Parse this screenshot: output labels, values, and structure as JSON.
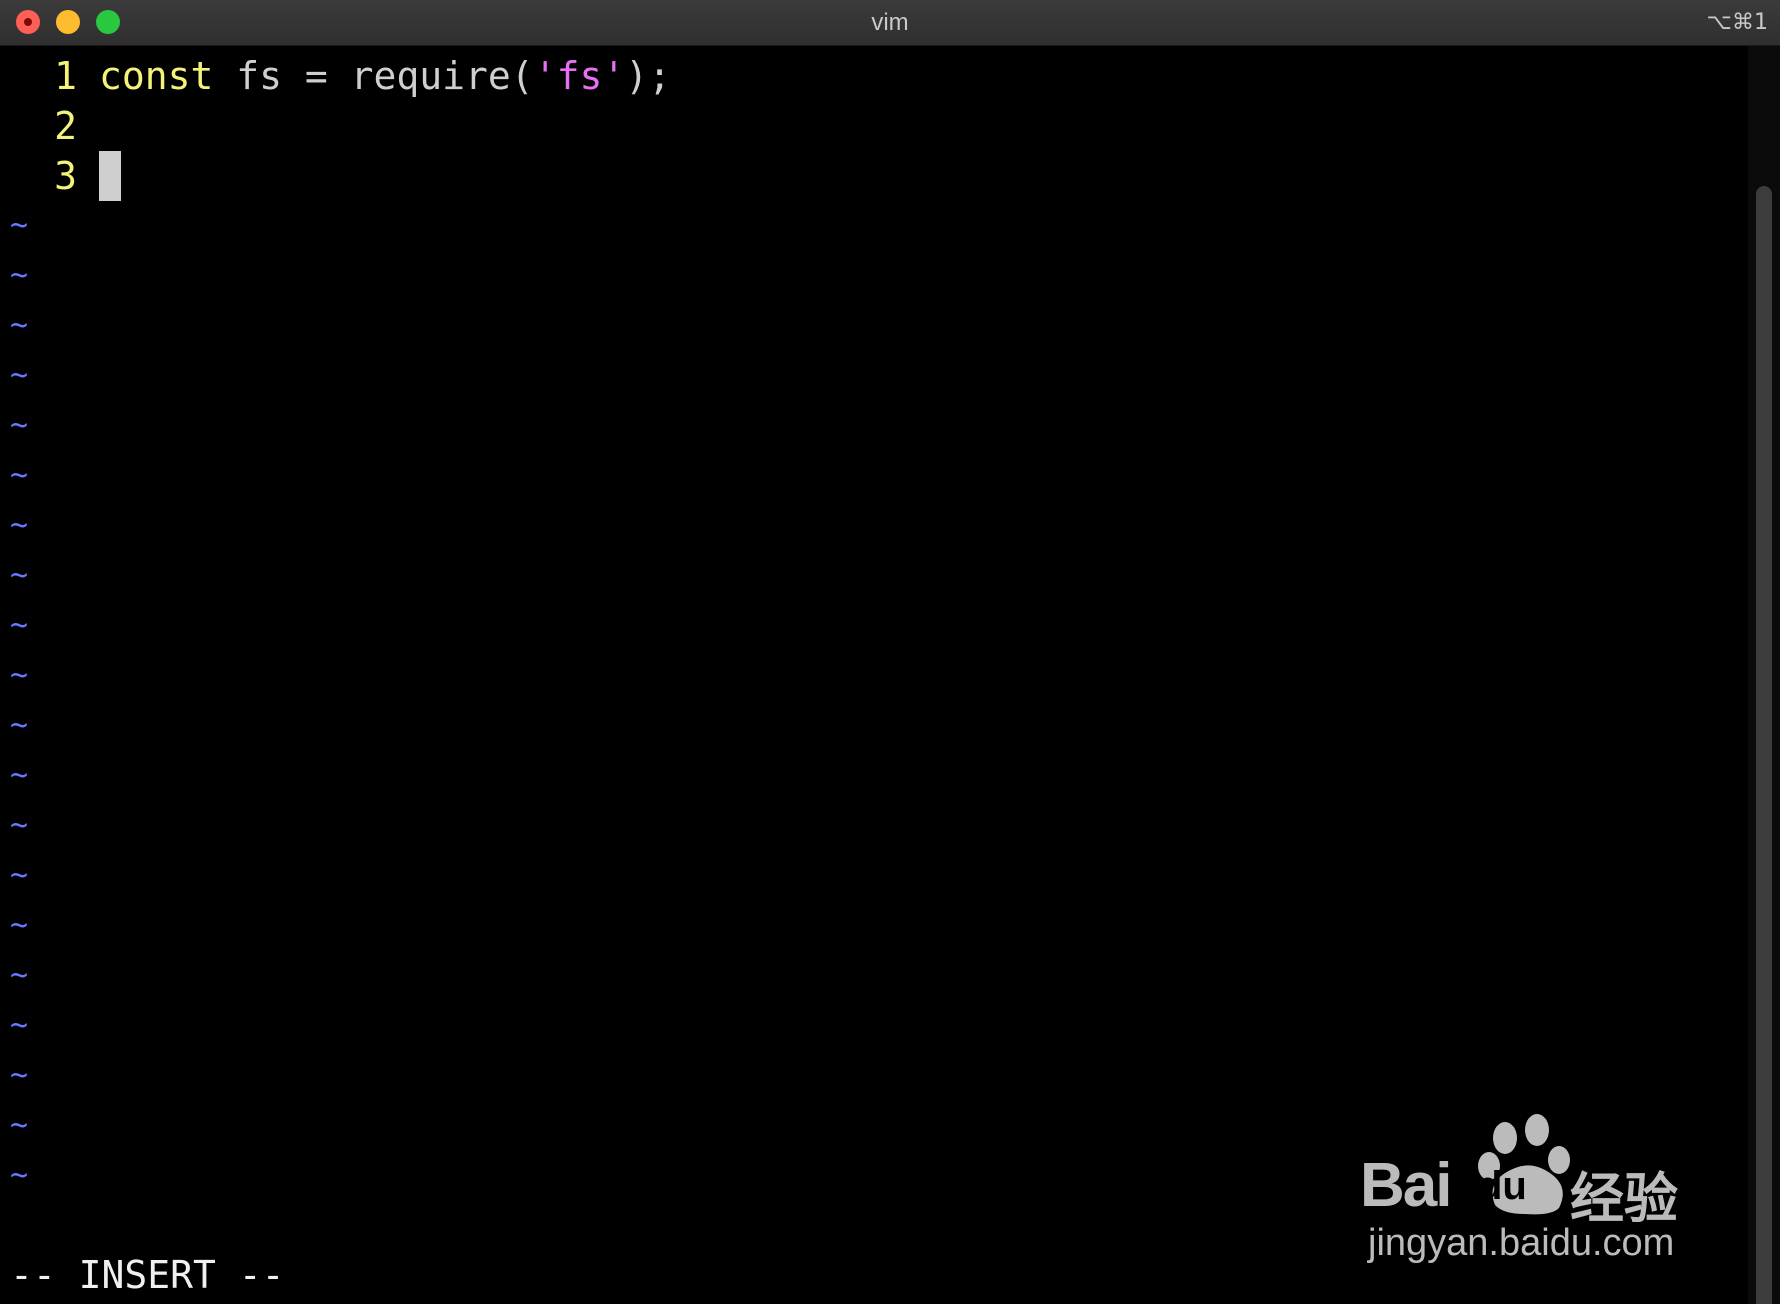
{
  "window": {
    "title": "vim",
    "shortcut": "⌥⌘1"
  },
  "editor": {
    "lines": [
      {
        "number": "1",
        "keyword": "const",
        "code": " fs = require(",
        "string": "'fs'",
        "tail": ");"
      },
      {
        "number": "2"
      },
      {
        "number": "3"
      }
    ],
    "empty_line_marker": "~",
    "mode": "-- INSERT --"
  },
  "watermark": {
    "brand": "Bai",
    "brand_mark": "du",
    "brand_cn": "经验",
    "url": "jingyan.baidu.com"
  },
  "colors": {
    "keyword": "#f3f37a",
    "line_number": "#f3f37a",
    "string": "#e86ef3",
    "tilde": "#6a78ff",
    "text": "#cfcfcf"
  }
}
